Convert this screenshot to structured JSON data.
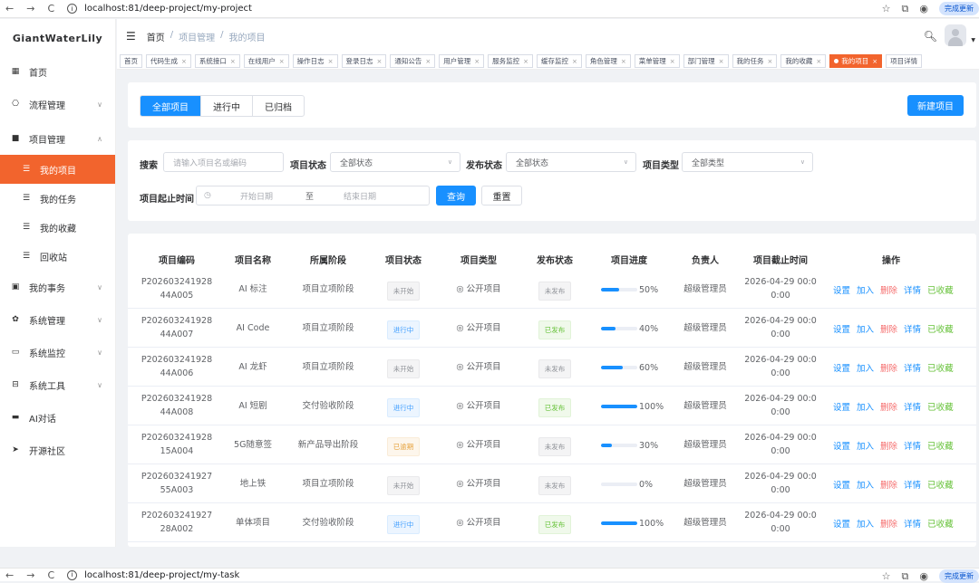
{
  "browser": {
    "url": "localhost:81/deep-project/my-project",
    "url2": "localhost:81/deep-project/my-task",
    "update_label": "完成更新"
  },
  "sidebar": {
    "logo": "GiantWaterLily",
    "items": [
      {
        "label": "首页",
        "icon": "dashboard-icon"
      },
      {
        "label": "流程管理",
        "icon": "flow-icon"
      },
      {
        "label": "项目管理",
        "icon": "folder-icon"
      },
      {
        "label": "我的项目",
        "icon": "list-icon"
      },
      {
        "label": "我的任务",
        "icon": "list-icon"
      },
      {
        "label": "我的收藏",
        "icon": "list-icon"
      },
      {
        "label": "回收站",
        "icon": "list-icon"
      },
      {
        "label": "我的事务",
        "icon": "doc-icon"
      },
      {
        "label": "系统管理",
        "icon": "gear-icon"
      },
      {
        "label": "系统监控",
        "icon": "monitor-icon"
      },
      {
        "label": "系统工具",
        "icon": "toolbox-icon"
      },
      {
        "label": "AI对话",
        "icon": "chat-icon"
      },
      {
        "label": "开源社区",
        "icon": "send-icon"
      }
    ]
  },
  "header": {
    "breadcrumb": [
      "首页",
      "项目管理",
      "我的项目"
    ]
  },
  "tags": [
    "首页",
    "代码生成",
    "系统接口",
    "在线用户",
    "操作日志",
    "登录日志",
    "通知公告",
    "用户管理",
    "服务监控",
    "缓存监控",
    "角色管理",
    "菜单管理",
    "部门管理",
    "我的任务",
    "我的收藏",
    "我的项目",
    "项目详情"
  ],
  "tabs": [
    "全部项目",
    "进行中",
    "已归档"
  ],
  "new_button": "新建项目",
  "filters": {
    "search_label": "搜索",
    "search_placeholder": "请输入项目名或编码",
    "status_label": "项目状态",
    "status_value": "全部状态",
    "publish_label": "发布状态",
    "publish_value": "全部状态",
    "type_label": "项目类型",
    "type_value": "全部类型",
    "date_label": "项目起止时间",
    "start_placeholder": "开始日期",
    "to": "至",
    "end_placeholder": "结束日期",
    "query": "查询",
    "reset": "重置"
  },
  "table": {
    "headers": [
      "项目编码",
      "项目名称",
      "所属阶段",
      "项目状态",
      "项目类型",
      "发布状态",
      "项目进度",
      "负责人",
      "项目截止时间",
      "操作"
    ],
    "ops": [
      "设置",
      "加入",
      "删除",
      "详情",
      "已收藏"
    ],
    "rows": [
      {
        "code1": "P202603241928",
        "code2": "44A005",
        "name": "AI 标注",
        "stage": "项目立项阶段",
        "status": "未开始",
        "type": "公开项目",
        "publish": "未发布",
        "progress": 50,
        "progress_text": "50%",
        "owner": "超级管理员",
        "deadline1": "2026-04-29 00:0",
        "deadline2": "0:00"
      },
      {
        "code1": "P202603241928",
        "code2": "44A007",
        "name": "AI Code",
        "stage": "项目立项阶段",
        "status": "进行中",
        "type": "公开项目",
        "publish": "已发布",
        "progress": 40,
        "progress_text": "40%",
        "owner": "超级管理员",
        "deadline1": "2026-04-29 00:0",
        "deadline2": "0:00"
      },
      {
        "code1": "P202603241928",
        "code2": "44A006",
        "name": "AI 龙虾",
        "stage": "项目立项阶段",
        "status": "未开始",
        "type": "公开项目",
        "publish": "未发布",
        "progress": 60,
        "progress_text": "60%",
        "owner": "超级管理员",
        "deadline1": "2026-04-29 00:0",
        "deadline2": "0:00"
      },
      {
        "code1": "P202603241928",
        "code2": "44A008",
        "name": "AI 短剧",
        "stage": "交付验收阶段",
        "status": "进行中",
        "type": "公开项目",
        "publish": "已发布",
        "progress": 100,
        "progress_text": "100%",
        "owner": "超级管理员",
        "deadline1": "2026-04-29 00:0",
        "deadline2": "0:00"
      },
      {
        "code1": "P202603241928",
        "code2": "15A004",
        "name": "5G随意签",
        "stage": "新产品导出阶段",
        "status": "已逾期",
        "type": "公开项目",
        "publish": "未发布",
        "progress": 30,
        "progress_text": "30%",
        "owner": "超级管理员",
        "deadline1": "2026-04-29 00:0",
        "deadline2": "0:00"
      },
      {
        "code1": "P202603241927",
        "code2": "55A003",
        "name": "地上铁",
        "stage": "项目立项阶段",
        "status": "未开始",
        "type": "公开项目",
        "publish": "未发布",
        "progress": 0,
        "progress_text": "0%",
        "owner": "超级管理员",
        "deadline1": "2026-04-29 00:0",
        "deadline2": "0:00"
      },
      {
        "code1": "P202603241927",
        "code2": "28A002",
        "name": "单体项目",
        "stage": "交付验收阶段",
        "status": "进行中",
        "type": "公开项目",
        "publish": "已发布",
        "progress": 100,
        "progress_text": "100%",
        "owner": "超级管理员",
        "deadline1": "2026-04-29 00:0",
        "deadline2": "0:00"
      }
    ]
  }
}
